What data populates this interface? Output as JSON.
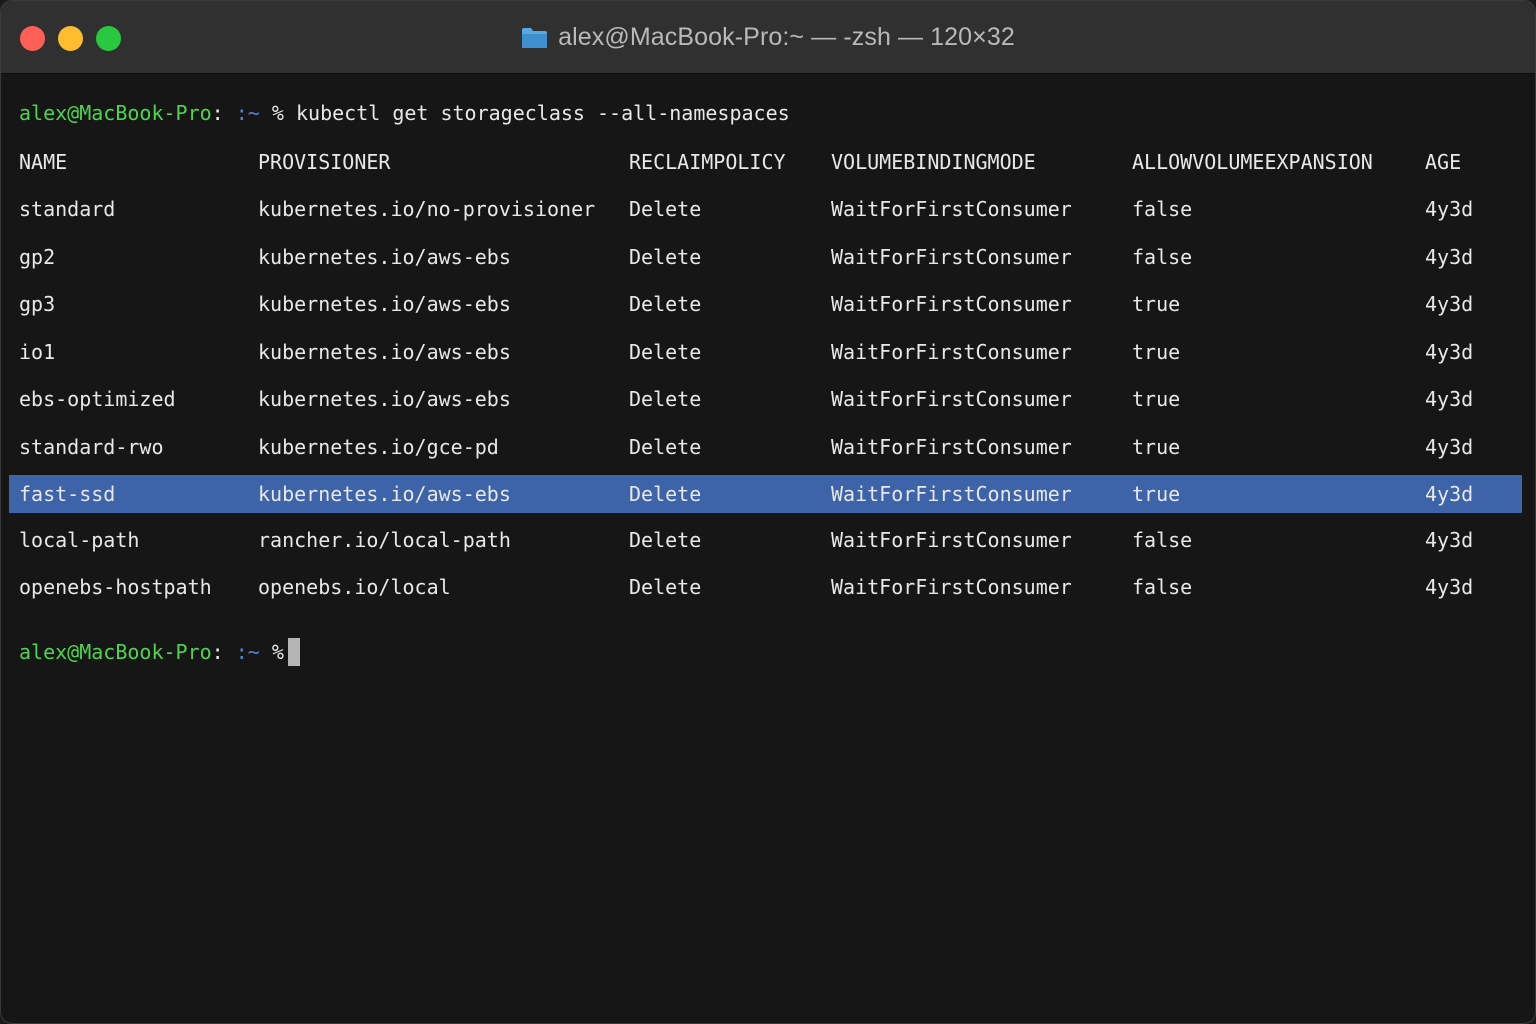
{
  "window": {
    "title": "alex@MacBook-Pro:~ — -zsh — 120×32"
  },
  "prompt": {
    "user_host": "alex@MacBook-Pro",
    "colon": ":",
    "path": ":~",
    "symbol": "%"
  },
  "command": "kubectl get storageclass --all-namespaces",
  "table": {
    "headers": [
      "NAME",
      "PROVISIONER",
      "RECLAIMPOLICY",
      "VOLUMEBINDINGMODE",
      "ALLOWVOLUMEEXPANSION",
      "AGE"
    ],
    "rows": [
      [
        "standard",
        "kubernetes.io/no-provisioner",
        "Delete",
        "WaitForFirstConsumer",
        "false",
        "4y3d"
      ],
      [
        "gp2",
        "kubernetes.io/aws-ebs",
        "Delete",
        "WaitForFirstConsumer",
        "false",
        "4y3d"
      ],
      [
        "gp3",
        "kubernetes.io/aws-ebs",
        "Delete",
        "WaitForFirstConsumer",
        "true",
        "4y3d"
      ],
      [
        "io1",
        "kubernetes.io/aws-ebs",
        "Delete",
        "WaitForFirstConsumer",
        "true",
        "4y3d"
      ],
      [
        "ebs-optimized",
        "kubernetes.io/aws-ebs",
        "Delete",
        "WaitForFirstConsumer",
        "true",
        "4y3d"
      ],
      [
        "standard-rwo",
        "kubernetes.io/gce-pd",
        "Delete",
        "WaitForFirstConsumer",
        "true",
        "4y3d"
      ],
      [
        "fast-ssd",
        "kubernetes.io/aws-ebs",
        "Delete",
        "WaitForFirstConsumer",
        "true",
        "4y3d"
      ],
      [
        "local-path",
        "rancher.io/local-path",
        "Delete",
        "WaitForFirstConsumer",
        "false",
        "4y3d"
      ],
      [
        "openebs-hostpath",
        "openebs.io/local",
        "Delete",
        "WaitForFirstConsumer",
        "false",
        "4y3d"
      ]
    ],
    "selected_row": 6
  },
  "colors": {
    "selection": "#3d63a8",
    "user": "#4fd44f",
    "path": "#5a7fd6"
  }
}
